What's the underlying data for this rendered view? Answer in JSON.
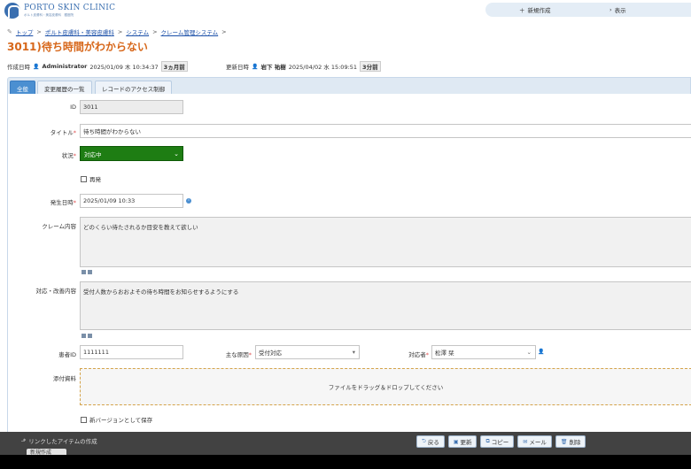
{
  "header": {
    "logo_name": "PORTO SKIN CLINIC",
    "logo_sub": "ポルト皮膚科・美容皮膚科　銀座院",
    "new_label": "新規作成",
    "view_label": "表示"
  },
  "breadcrumb": {
    "items": [
      "トップ",
      "ポルト皮膚科・美容皮膚科",
      "システム",
      "クレーム管理システム"
    ]
  },
  "title": "3011)待ち時間がわからない",
  "meta": {
    "created_label": "作成日時",
    "created_user": "Administrator",
    "created_date": "2025/01/09 木 10:34:37",
    "created_ago": "3ヵ月前",
    "updated_label": "更新日時",
    "updated_user": "岩下 祐樹",
    "updated_date": "2025/04/02 水 15:09:51",
    "updated_ago": "3分前"
  },
  "tabs": [
    "全般",
    "変更履歴の一覧",
    "レコードのアクセス制御"
  ],
  "form": {
    "id_label": "ID",
    "id_value": "3011",
    "title_label": "タイトル",
    "title_value": "待ち時間がわからない",
    "status_label": "状況",
    "status_value": "対応中",
    "recur_label": "再発",
    "date_label": "発生日時",
    "date_value": "2025/01/09 10:33",
    "claim_label": "クレーム内容",
    "claim_value": "どのくらい待たされるか目安を教えて欲しい",
    "response_label": "対応・改善内容",
    "response_value": "受付人数からおおよその待ち時間をお知らせするようにする",
    "patient_label": "患者ID",
    "patient_value": "1111111",
    "cause_label": "主な原因",
    "cause_value": "受付対応",
    "handler_label": "対応者",
    "handler_value": "松澤 栞",
    "attach_label": "添付資料",
    "attach_drop": "ファイルをドラッグ＆ドロップしてください",
    "newversion_label": "新バージョンとして保存"
  },
  "footer": {
    "linked_label": "リンクしたアイテムの作成",
    "partial_label": "新規作成",
    "back": "戻る",
    "update": "更新",
    "copy": "コピー",
    "mail": "メール",
    "delete": "削除"
  }
}
